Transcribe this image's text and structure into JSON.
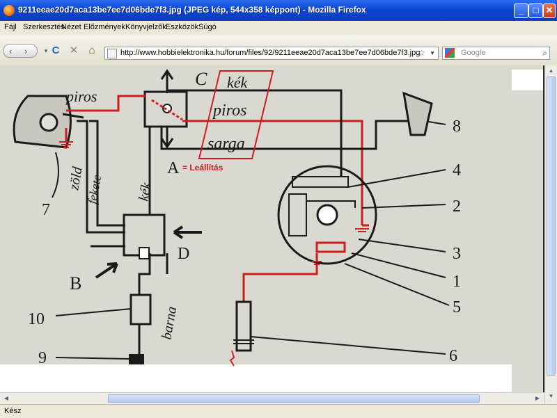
{
  "window": {
    "title": "9211eeae20d7aca13be7ee7d06bde7f3.jpg (JPEG kép, 544x358 képpont) - Mozilla Firefox",
    "minimize": "_",
    "maximize": "□",
    "close": "✕"
  },
  "menu": {
    "items": [
      "Fájl",
      "Szerkesztés",
      "Nézet",
      "Előzmények",
      "Könyvjelzők",
      "Eszközök",
      "Súgó"
    ]
  },
  "toolbar": {
    "back": "‹",
    "forward": "›",
    "reload": "C",
    "stop": "✕",
    "home": "⌂",
    "url": "http://www.hobbielektronika.hu/forum/files/92/9211eeae20d7aca13be7ee7d06bde7f3.jpg",
    "search_placeholder": "Google",
    "search_icon": "search-icon"
  },
  "diagram": {
    "labels": {
      "c": "C",
      "kek_top": "kék",
      "piros_mid": "piros",
      "sarga": "sarga",
      "piros_left": "piros",
      "a": "A",
      "leallitas": "= Leállítás",
      "zold": "zöld",
      "fekete": "fekete",
      "kek_side": "kék",
      "num7": "7",
      "num8": "8",
      "num4": "4",
      "num2": "2",
      "num3": "3",
      "num1": "1",
      "num5": "5",
      "num6": "6",
      "b": "B",
      "d": "D",
      "num10": "10",
      "num9": "9",
      "barna": "barna"
    },
    "colors": {
      "paper": "#dcdcd4",
      "ink": "#1a1a1a",
      "red": "#cc1e1e"
    }
  },
  "status": {
    "text": "Kész"
  }
}
